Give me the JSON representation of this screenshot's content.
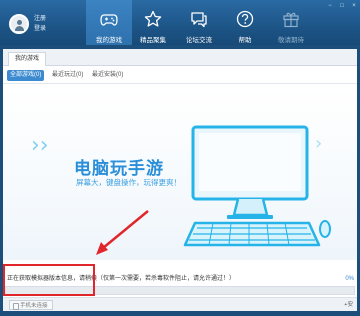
{
  "header": {
    "login": {
      "register": "注册",
      "sign_in": "登录"
    },
    "nav": [
      {
        "label": "我的游戏",
        "icon": "gamepad-icon",
        "active": true
      },
      {
        "label": "精品聚集",
        "icon": "star-icon",
        "active": false
      },
      {
        "label": "论坛交流",
        "icon": "chat-bubble-icon",
        "active": false
      },
      {
        "label": "帮助",
        "icon": "help-icon",
        "active": false
      },
      {
        "label": "敬请期待",
        "icon": "gift-icon",
        "active": false
      }
    ],
    "window_controls": [
      "−",
      "□",
      "×"
    ]
  },
  "tabs": {
    "my_games": "我的游戏"
  },
  "filters": [
    {
      "label": "全部游戏(0)",
      "active": true
    },
    {
      "label": "最近玩过(0)",
      "active": false
    },
    {
      "label": "最近安装(0)",
      "active": false
    }
  ],
  "banner": {
    "title": "电脑玩手游",
    "subtitle": "屏幕大，键盘操作，玩得更爽！",
    "slide_count": 4,
    "current_slide": 0
  },
  "status": {
    "message": "正在获取模拟器版本信息，请稍候（仅第一次需要，若杀毒软件阻止，请允许通过！）",
    "percent_label": "0%",
    "progress": 0
  },
  "footer": {
    "mobile_button": "手机未连接",
    "right_label": "+安"
  },
  "colors": {
    "accent": "#3c8ad0",
    "header": "#1d5587",
    "annotation": "#e0262b"
  }
}
